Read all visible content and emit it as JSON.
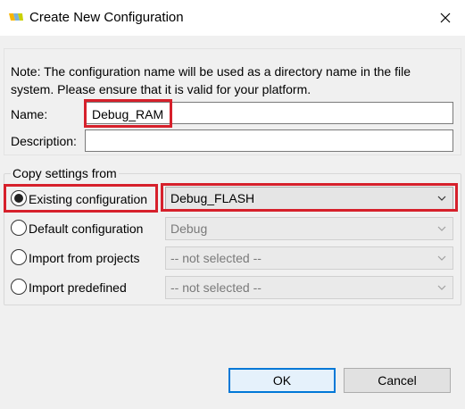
{
  "window": {
    "title": "Create New Configuration",
    "close_glyph": "✕"
  },
  "note": {
    "text": "Note: The configuration name will be used as a directory name in the file system.  Please ensure that it is valid for your platform."
  },
  "form": {
    "name_label": "Name:",
    "name_value": "Debug_RAM",
    "description_label": "Description:",
    "description_value": ""
  },
  "copy_settings": {
    "title": "Copy settings from",
    "options": [
      {
        "label": "Existing configuration",
        "selected": true,
        "combo_value": "Debug_FLASH",
        "combo_enabled": true
      },
      {
        "label": "Default configuration",
        "selected": false,
        "combo_value": "Debug",
        "combo_enabled": false
      },
      {
        "label": "Import from projects",
        "selected": false,
        "combo_value": "-- not selected --",
        "combo_enabled": false
      },
      {
        "label": "Import predefined",
        "selected": false,
        "combo_value": "-- not selected --",
        "combo_enabled": false
      }
    ]
  },
  "buttons": {
    "ok": "OK",
    "cancel": "Cancel"
  },
  "icons": {
    "app": "nxp-logo-icon",
    "close": "close-icon",
    "dropdown": "chevron-down-icon"
  },
  "colors": {
    "highlight_box": "#d6202b",
    "default_button_border": "#0078d7"
  }
}
